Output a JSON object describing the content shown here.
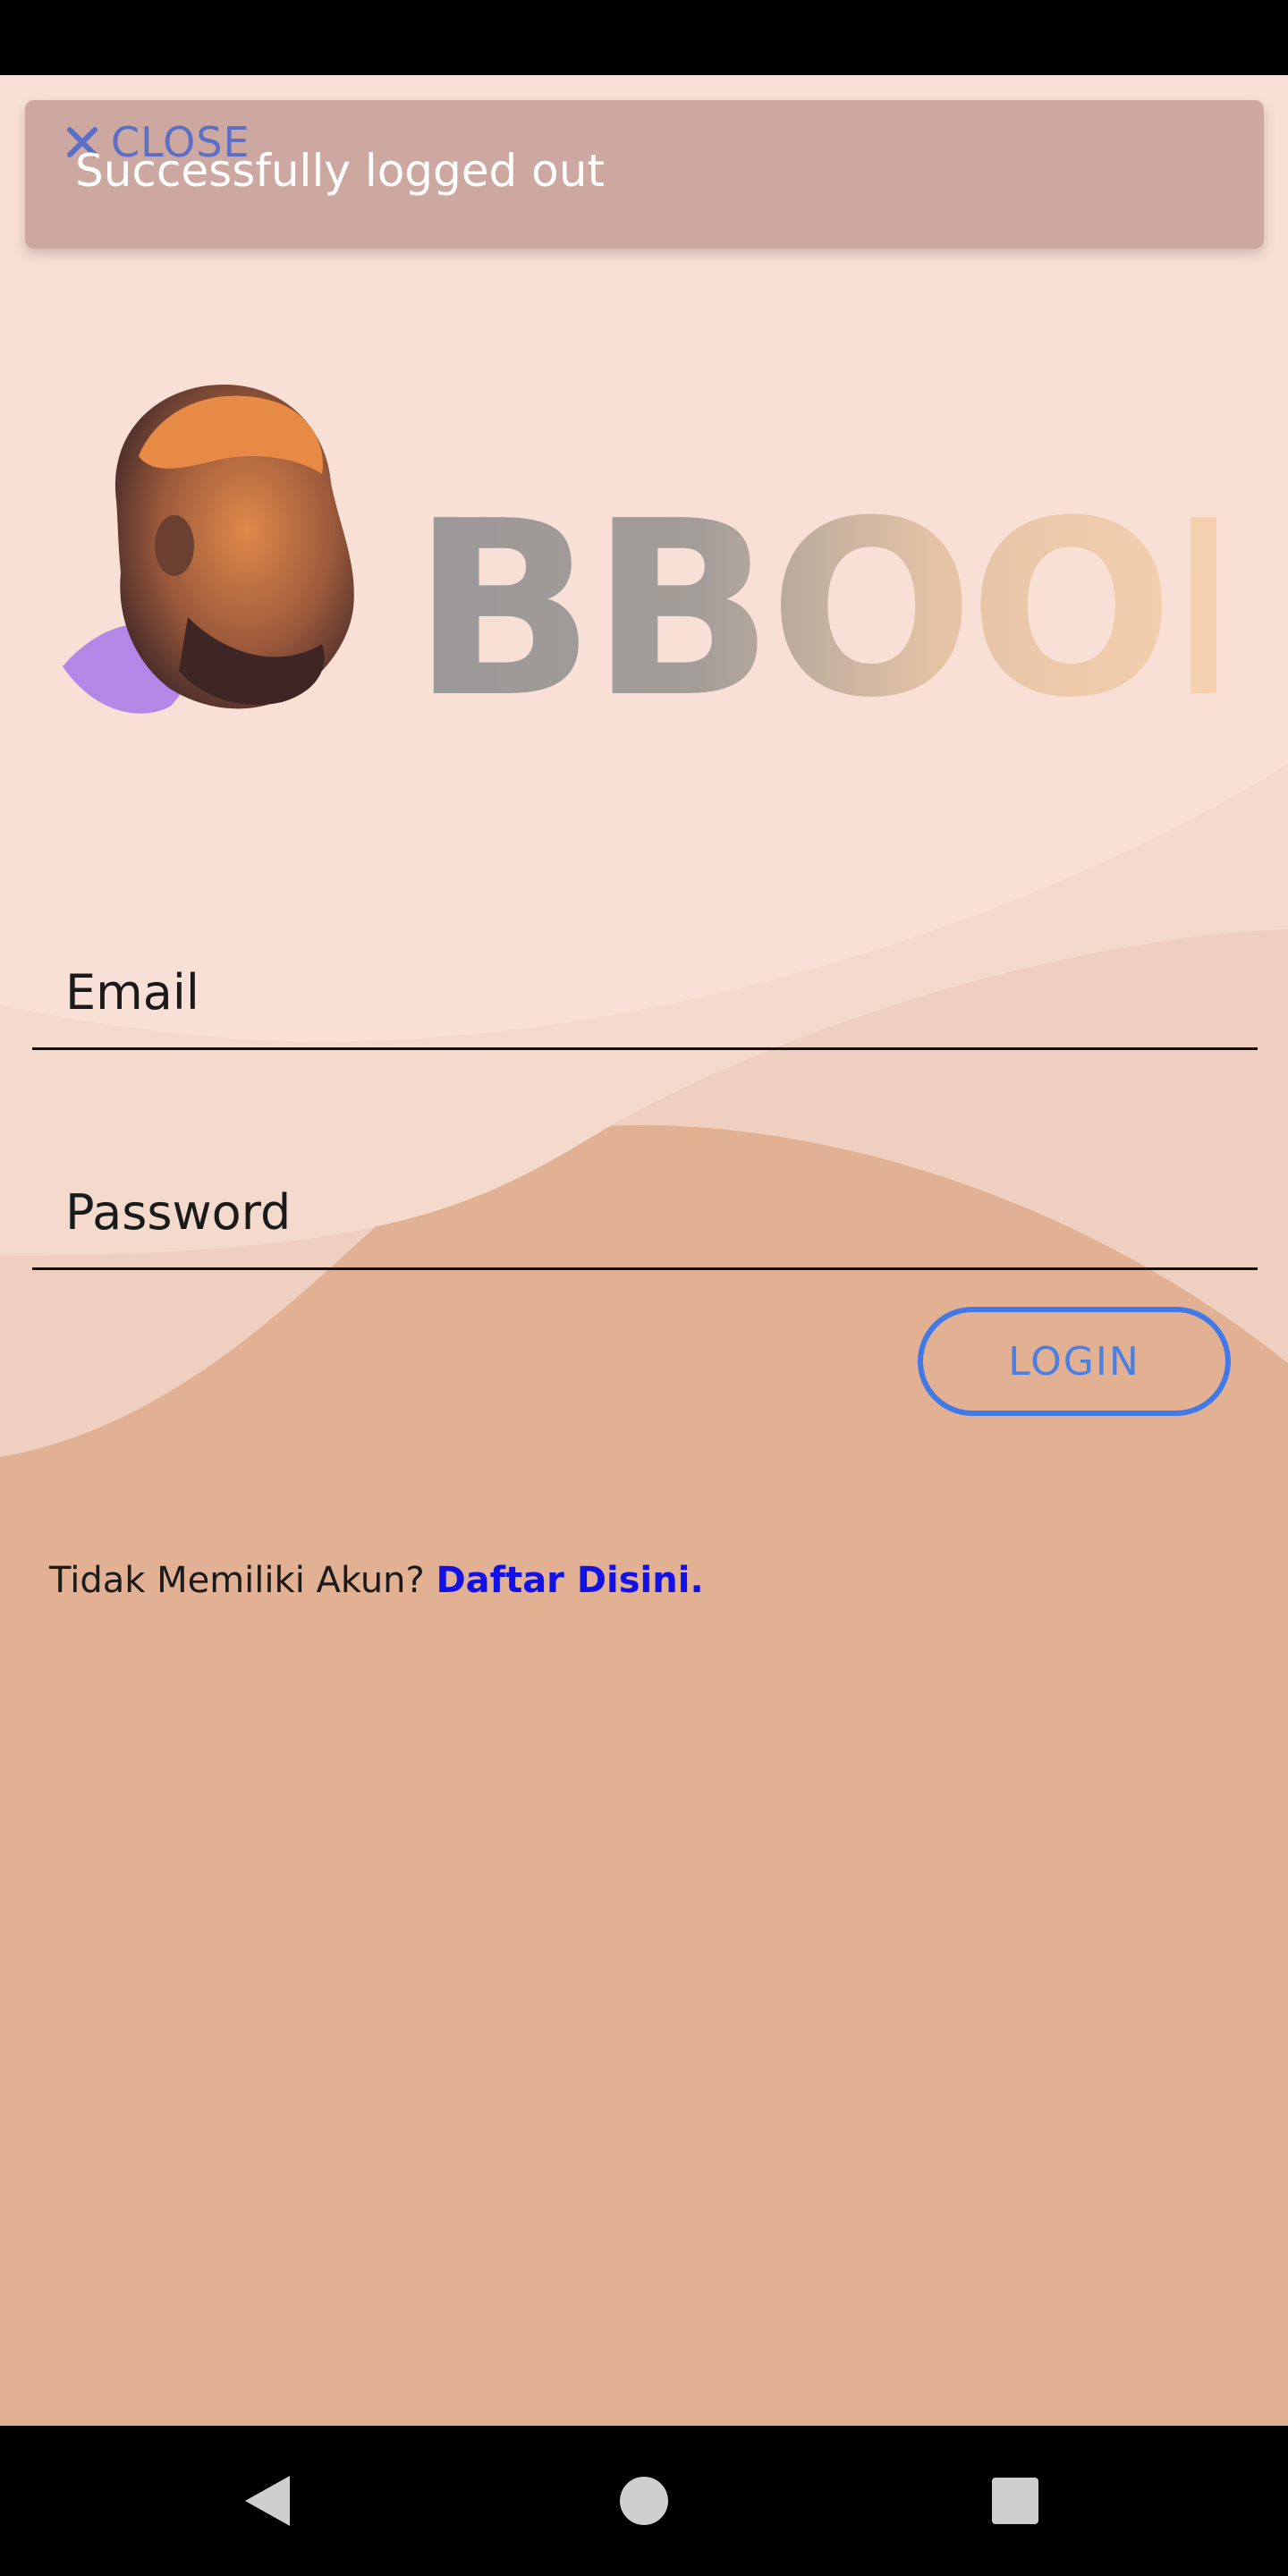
{
  "toast": {
    "close_label": "CLOSE",
    "message": "Successfully logged out"
  },
  "logo": {
    "wordmark": "BBOOK"
  },
  "form": {
    "email_placeholder": "Email",
    "password_placeholder": "Password",
    "login_label": "LOGIN"
  },
  "register": {
    "prompt": "Tidak Memiliki Akun? ",
    "link_label": "Daftar Disini."
  },
  "icons": {
    "close": "close-icon",
    "back": "back-triangle-icon",
    "home": "home-circle-icon",
    "recents": "recents-square-icon"
  },
  "colors": {
    "background_top": "#f8e0d6",
    "background_bottom": "#e2b093",
    "accent": "#4179e8",
    "link": "#1212e6",
    "toast": "#cca8a1"
  }
}
